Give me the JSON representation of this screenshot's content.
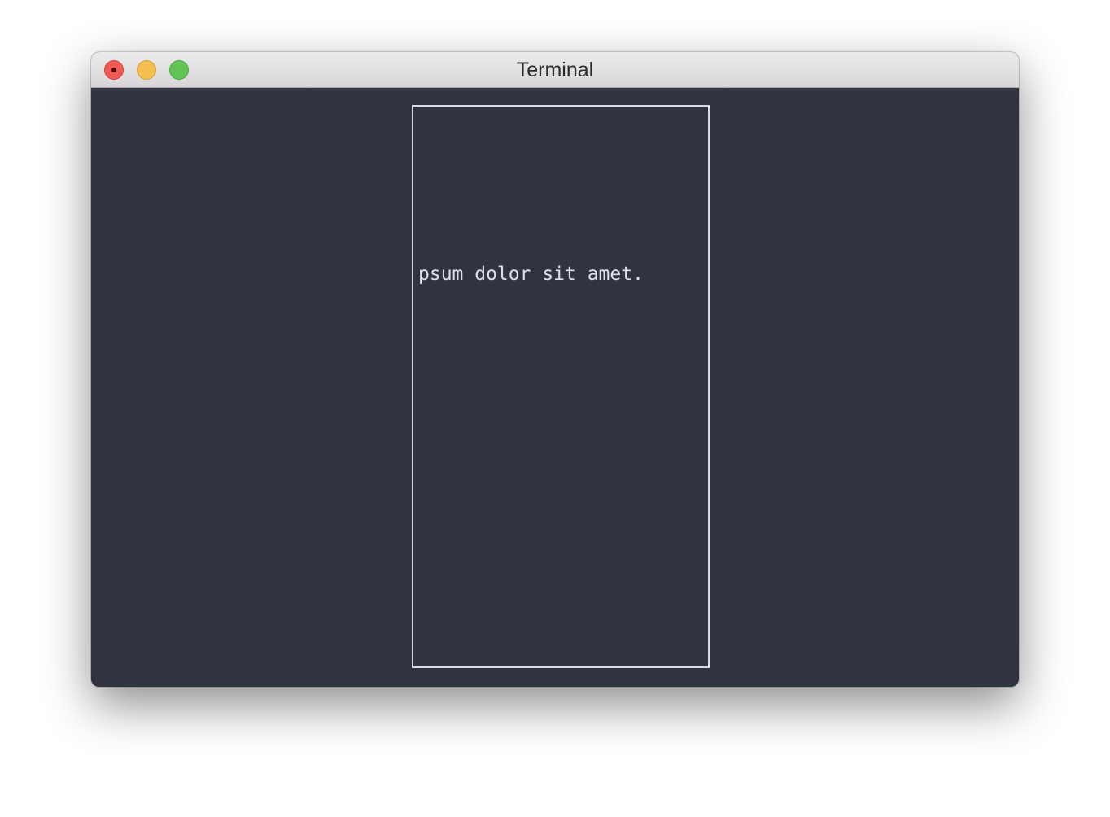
{
  "window": {
    "title": "Terminal"
  },
  "terminal": {
    "text": "psum dolor sit amet."
  },
  "icons": {
    "close": "close-icon",
    "minimize": "minimize-icon",
    "zoom": "zoom-icon"
  },
  "colors": {
    "terminal_background": "#30343f",
    "panel_border": "#d8dbe3",
    "text": "#dde1ea",
    "close": "#f05b55",
    "minimize": "#f5bf4f",
    "zoom": "#61c454"
  }
}
